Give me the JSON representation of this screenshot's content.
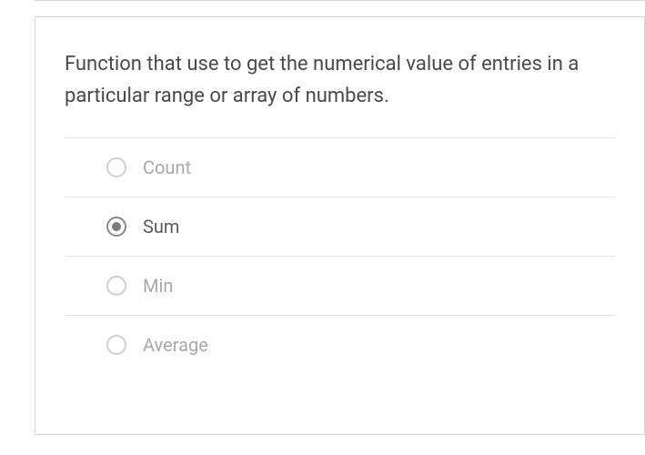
{
  "question": {
    "text": "Function that use to  get the numerical value of entries in a particular range or array of numbers.",
    "options": [
      {
        "label": "Count",
        "selected": false
      },
      {
        "label": "Sum",
        "selected": true
      },
      {
        "label": "Min",
        "selected": false
      },
      {
        "label": "Average",
        "selected": false
      }
    ]
  }
}
